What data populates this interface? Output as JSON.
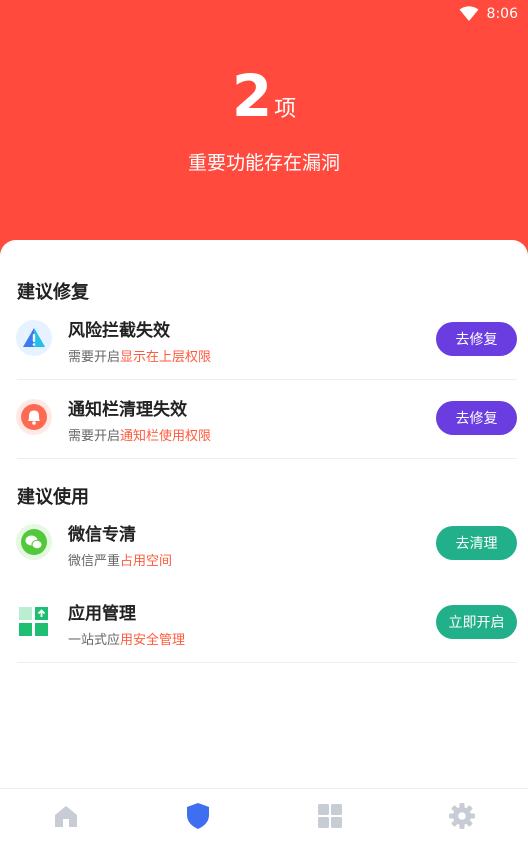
{
  "status_bar": {
    "time": "8:06",
    "wifi_icon": "wifi-icon"
  },
  "header": {
    "count": "2",
    "unit": "项",
    "subtitle": "重要功能存在漏洞"
  },
  "sections": [
    {
      "title": "建议修复",
      "items": [
        {
          "title": "风险拦截失效",
          "desc_prefix": "需要开启",
          "desc_highlight": "显示在上层权限",
          "button": "去修复",
          "icon": "warning-triangle-icon"
        },
        {
          "title": "通知栏清理失效",
          "desc_prefix": "需要开启",
          "desc_highlight": "通知栏使用权限",
          "button": "去修复",
          "icon": "bell-icon"
        }
      ]
    },
    {
      "title": "建议使用",
      "items": [
        {
          "title": "微信专清",
          "desc_prefix": "微信严重",
          "desc_highlight": "占用空间",
          "button": "去清理",
          "icon": "wechat-icon"
        },
        {
          "title": "应用管理",
          "desc_prefix": "一站式应",
          "desc_highlight": "用安全管理",
          "button": "立即开启",
          "icon": "app-grid-icon"
        }
      ]
    }
  ],
  "tabbar": [
    {
      "icon": "home-icon",
      "active": false
    },
    {
      "icon": "shield-icon",
      "active": true
    },
    {
      "icon": "grid-icon",
      "active": false
    },
    {
      "icon": "gear-icon",
      "active": false
    }
  ],
  "colors": {
    "hero": "#ff4a3d",
    "highlight": "#ff5a3c",
    "repair_button": "#6a3de0",
    "use_button": "#22b08a",
    "active_tab": "#3d6ff0",
    "inactive_tab": "#c8ccd4"
  }
}
